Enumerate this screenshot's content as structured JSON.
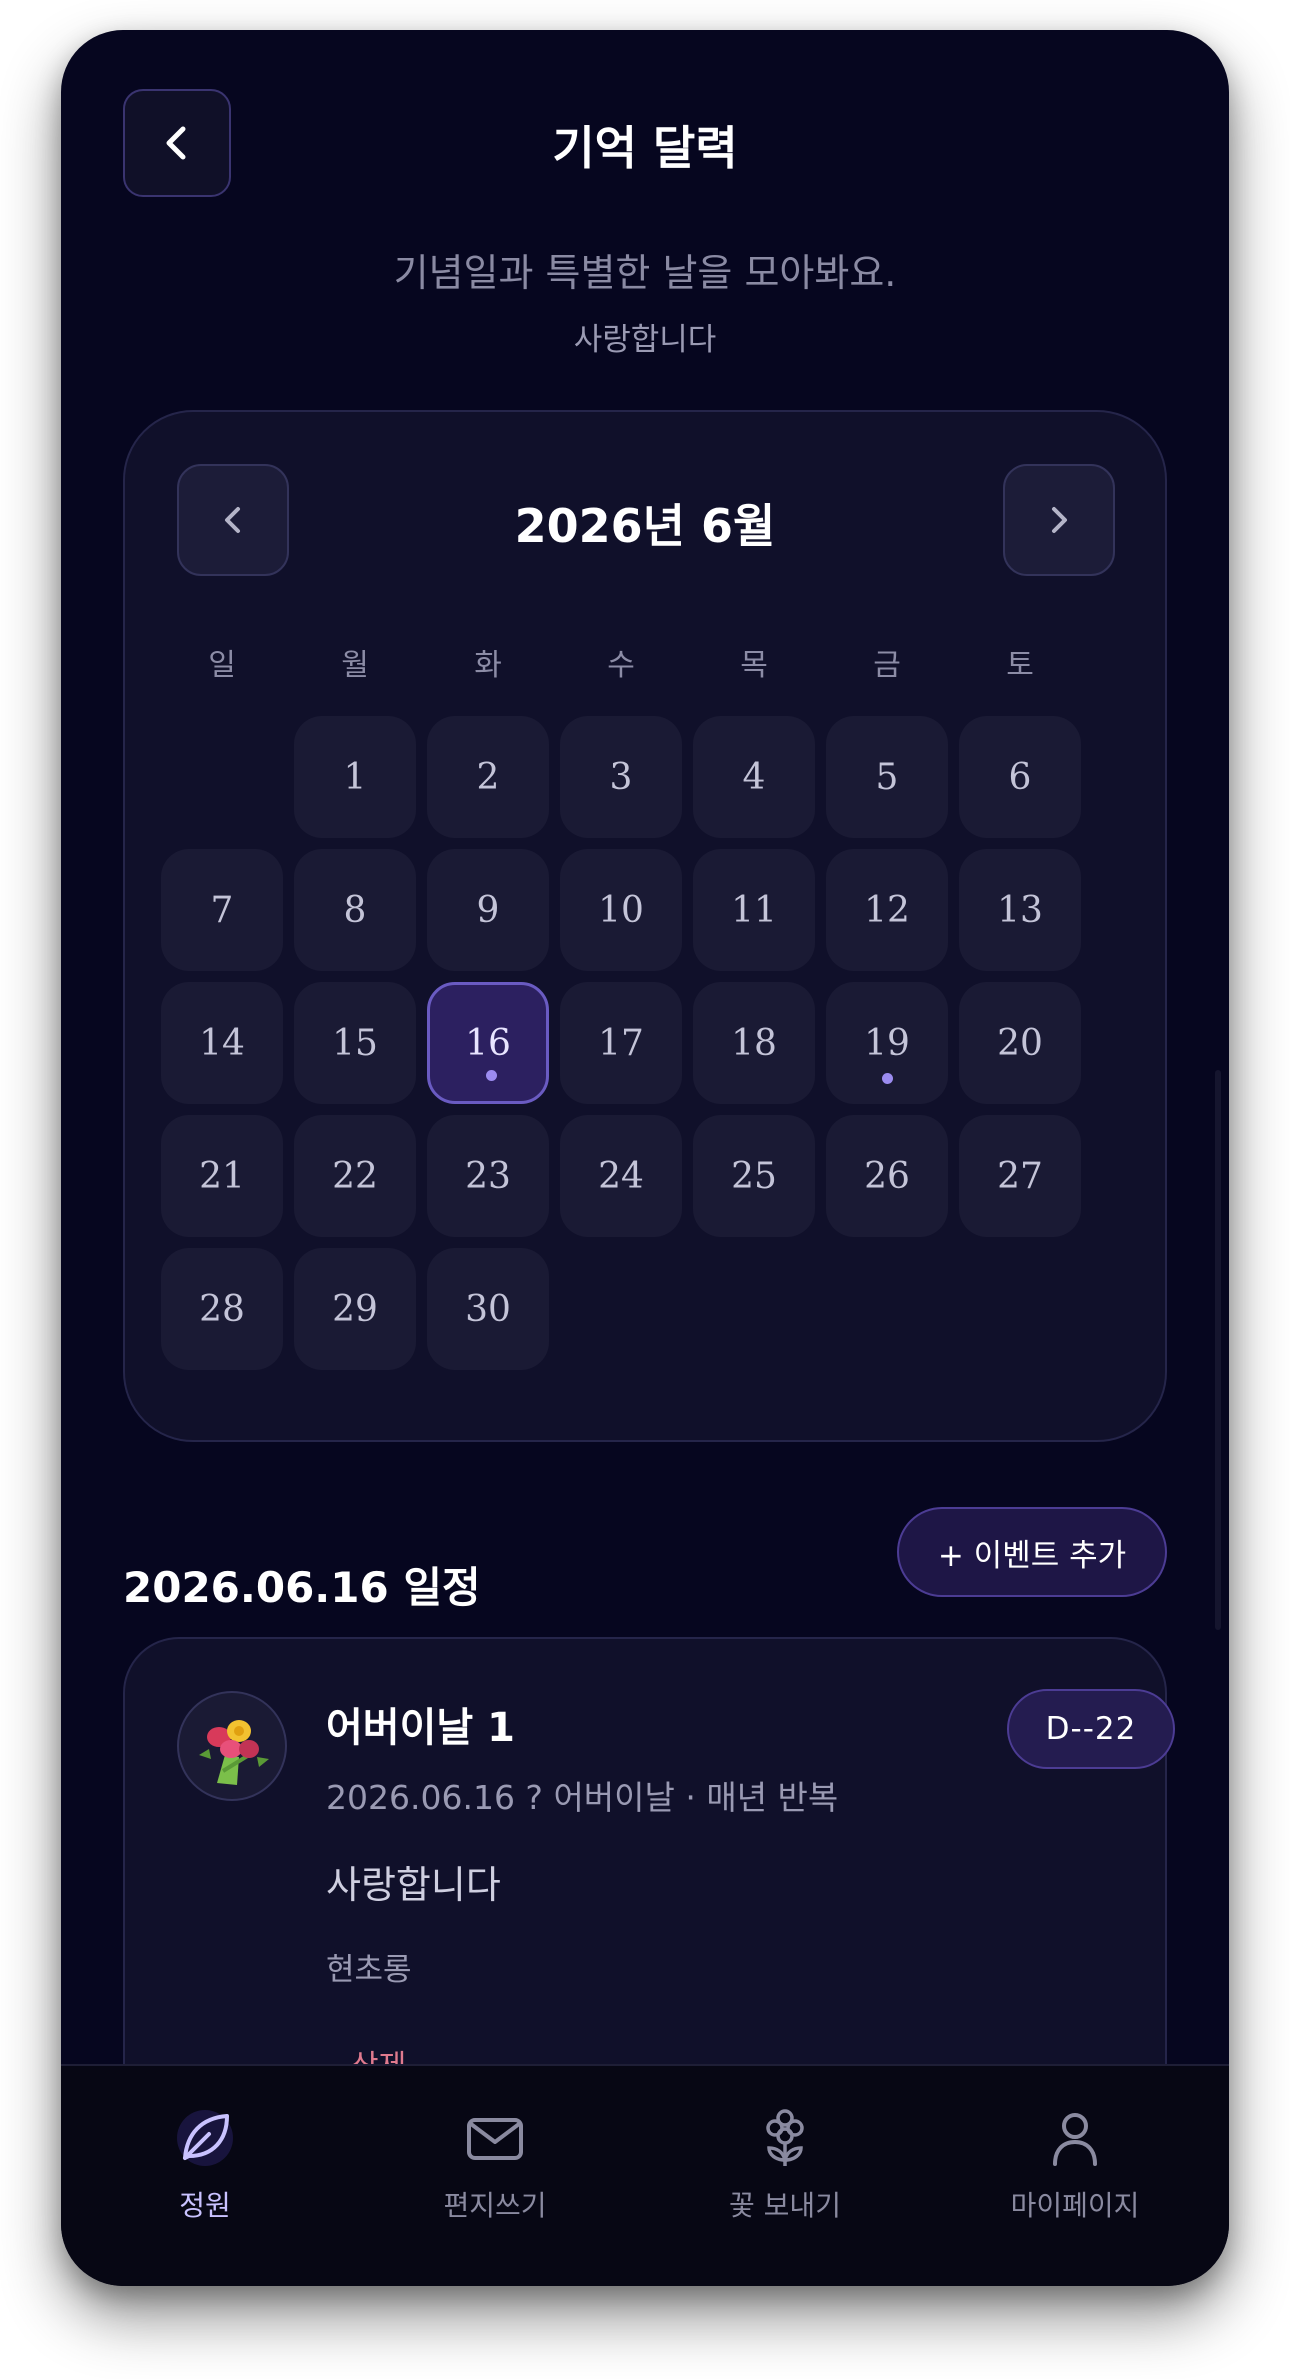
{
  "header": {
    "title": "기억 달력",
    "subtitle": "기념일과 특별한 날을 모아봐요.",
    "subnote": "사랑합니다"
  },
  "calendar": {
    "month_label": "2026년 6월",
    "weekdays": [
      "일",
      "월",
      "화",
      "수",
      "목",
      "금",
      "토"
    ],
    "days": [
      "1",
      "2",
      "3",
      "4",
      "5",
      "6",
      "7",
      "8",
      "9",
      "10",
      "11",
      "12",
      "13",
      "14",
      "15",
      "16",
      "17",
      "18",
      "19",
      "20",
      "21",
      "22",
      "23",
      "24",
      "25",
      "26",
      "27",
      "28",
      "29",
      "30"
    ],
    "selected_day": "16",
    "event_days": [
      "16",
      "19"
    ]
  },
  "schedule": {
    "title": "2026.06.16 일정",
    "add_button": "+ 이벤트 추가"
  },
  "event": {
    "title": "어버이날 1",
    "dday": "D--22",
    "meta": "2026.06.16 ? 어버이날 · 매년 반복",
    "memo": "사랑합니다",
    "author": "현초롱",
    "delete_label": "삭제"
  },
  "tabs": [
    {
      "label": "정원",
      "icon": "leaf-icon",
      "active": true
    },
    {
      "label": "편지쓰기",
      "icon": "mail-icon",
      "active": false
    },
    {
      "label": "꽃 보내기",
      "icon": "flower-icon",
      "active": false
    },
    {
      "label": "마이페이지",
      "icon": "user-icon",
      "active": false
    }
  ],
  "colors": {
    "background": "#06061f",
    "card": "#10102a",
    "accent": "#6a5bc2",
    "active_tab": "#c9c2ff",
    "danger": "#e07a8e"
  }
}
